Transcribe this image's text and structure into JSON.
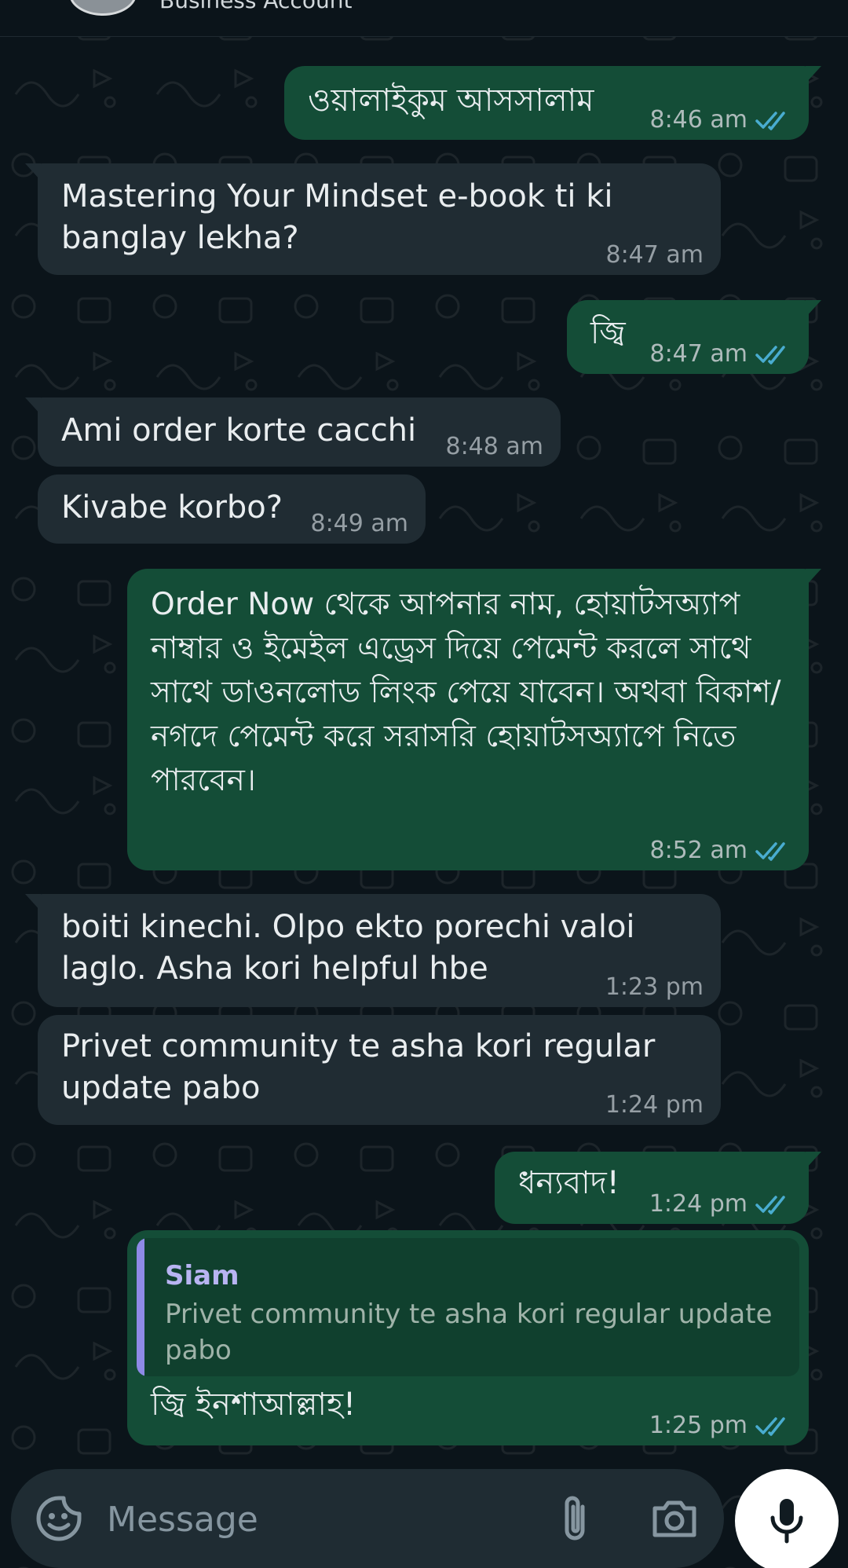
{
  "header": {
    "subtitle": "Business Account"
  },
  "messages": [
    {
      "direction": "outgoing",
      "text": "ওয়ালাইকুম আসসালাম",
      "time": "8:46 am",
      "status": "read"
    },
    {
      "direction": "incoming",
      "text": "Mastering Your Mindset e-book ti ki banglay lekha?",
      "time": "8:47 am"
    },
    {
      "direction": "outgoing",
      "text": "জ্বি",
      "time": "8:47 am",
      "status": "read"
    },
    {
      "direction": "incoming",
      "text": "Ami order korte cacchi",
      "time": "8:48 am"
    },
    {
      "direction": "incoming",
      "text": "Kivabe korbo?",
      "time": "8:49 am"
    },
    {
      "direction": "outgoing",
      "text": "Order Now থেকে আপনার নাম, হোয়াটসঅ্যাপ নাম্বার ও ইমেইল এড্রেস দিয়ে পেমেন্ট করলে সাথে সাথে ডাওনলোড লিংক পেয়ে যাবেন। অথবা বিকাশ/নগদে পেমেন্ট করে সরাসরি হোয়াটসঅ্যাপে নিতে পারবেন।",
      "time": "8:52 am",
      "status": "read"
    },
    {
      "direction": "incoming",
      "text": "boiti kinechi. Olpo ekto porechi valoi laglo. Asha kori helpful hbe",
      "time": "1:23 pm"
    },
    {
      "direction": "incoming",
      "text": "Privet community te asha kori regular update pabo",
      "time": "1:24 pm"
    },
    {
      "direction": "outgoing",
      "text": "ধন্যবাদ!",
      "time": "1:24 pm",
      "status": "read"
    },
    {
      "direction": "outgoing",
      "reply_to": {
        "name": "Siam",
        "text": "Privet community te asha kori regular update pabo"
      },
      "text": "জ্বি ইনশাআল্লাহ!",
      "time": "1:25 pm",
      "status": "read"
    }
  ],
  "composer": {
    "placeholder": "Message",
    "icons": [
      "emoji-icon",
      "paperclip-icon",
      "camera-icon",
      "microphone-icon"
    ]
  },
  "colors": {
    "background": "#0b141a",
    "outgoing_bubble": "#144d37",
    "incoming_bubble": "#202c33",
    "read_ticks": "#53bdeb",
    "quote_accent": "#8e8ae6"
  }
}
